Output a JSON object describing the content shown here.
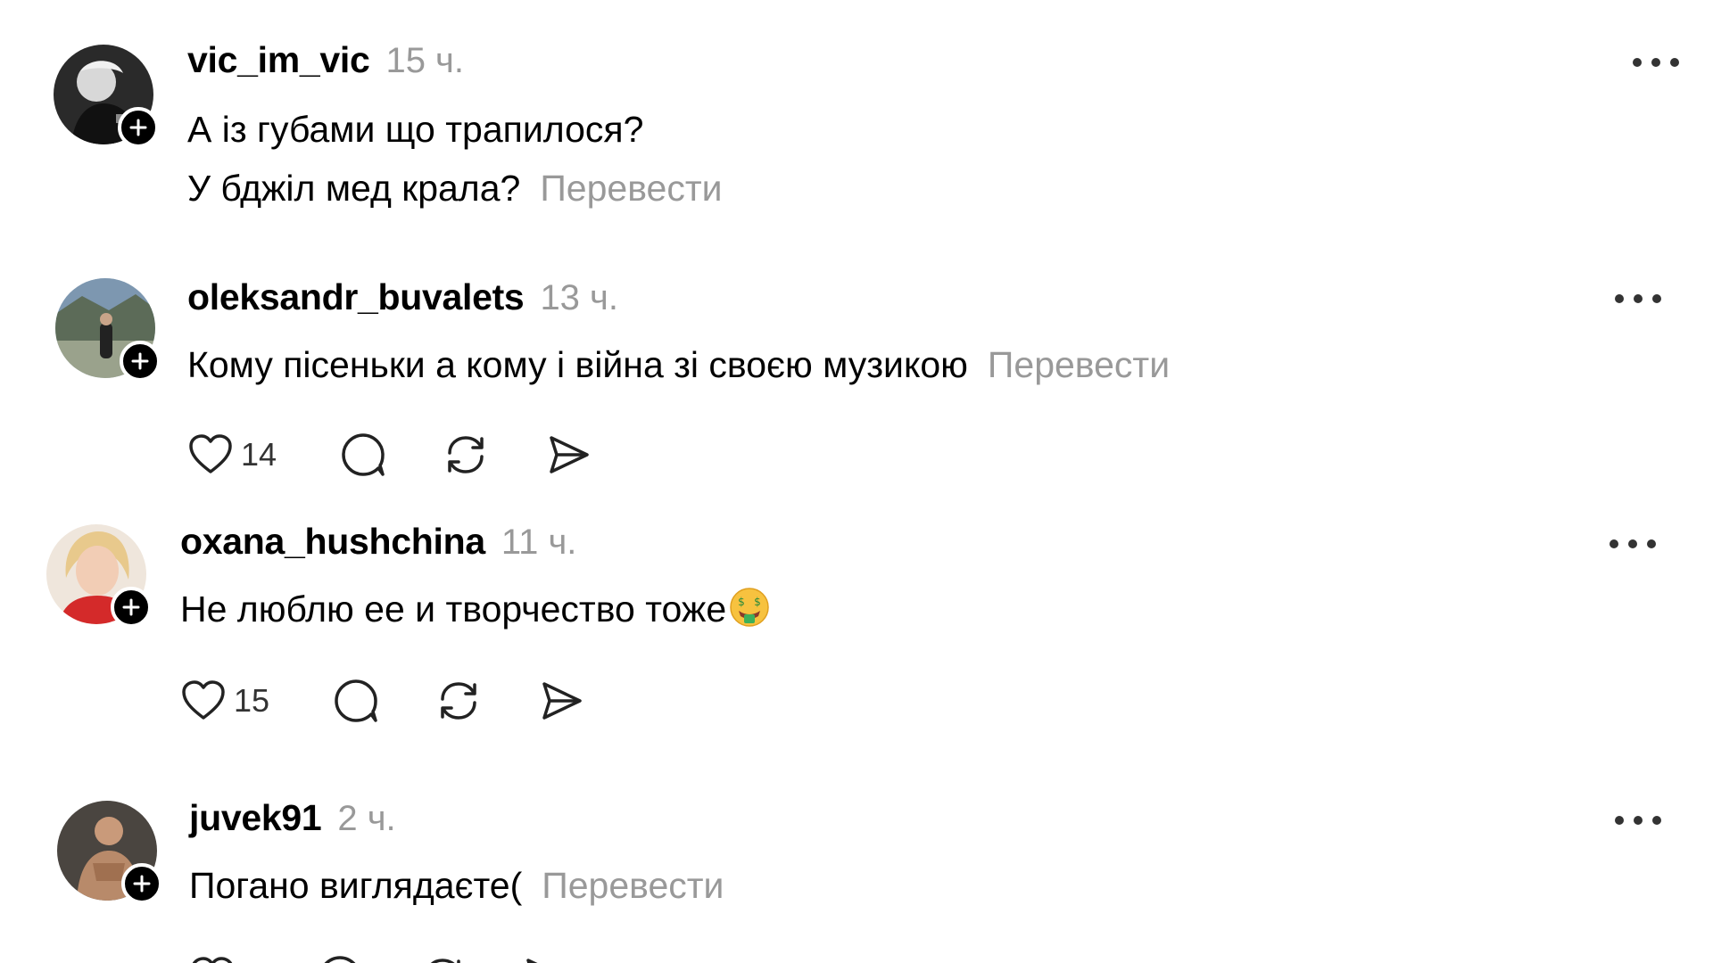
{
  "comments": [
    {
      "username": "vic_im_vic",
      "time": "15 ч.",
      "lines": [
        "А із губами що трапилося?",
        "У бджіл мед крала?"
      ],
      "translate": "Перевести"
    },
    {
      "username": "oleksandr_buvalets",
      "time": "13 ч.",
      "lines": [
        "Кому пісеньки а кому і війна зі своєю музикою"
      ],
      "translate": "Перевести",
      "likes": "14"
    },
    {
      "username": "oxana_hushchina",
      "time": "11 ч.",
      "lines": [
        "Не люблю ее и творчество тоже"
      ],
      "emoji": "money-mouth-face",
      "likes": "15"
    },
    {
      "username": "juvek91",
      "time": "2 ч.",
      "lines": [
        "Погано виглядаєте("
      ],
      "translate": "Перевести"
    }
  ],
  "icons": {
    "like": "heart-icon",
    "reply": "comment-icon",
    "repost": "repost-icon",
    "share": "send-icon",
    "more": "more-icon",
    "follow": "plus-icon"
  },
  "colors": {
    "text": "#000000",
    "muted": "#999999",
    "background": "#ffffff"
  }
}
